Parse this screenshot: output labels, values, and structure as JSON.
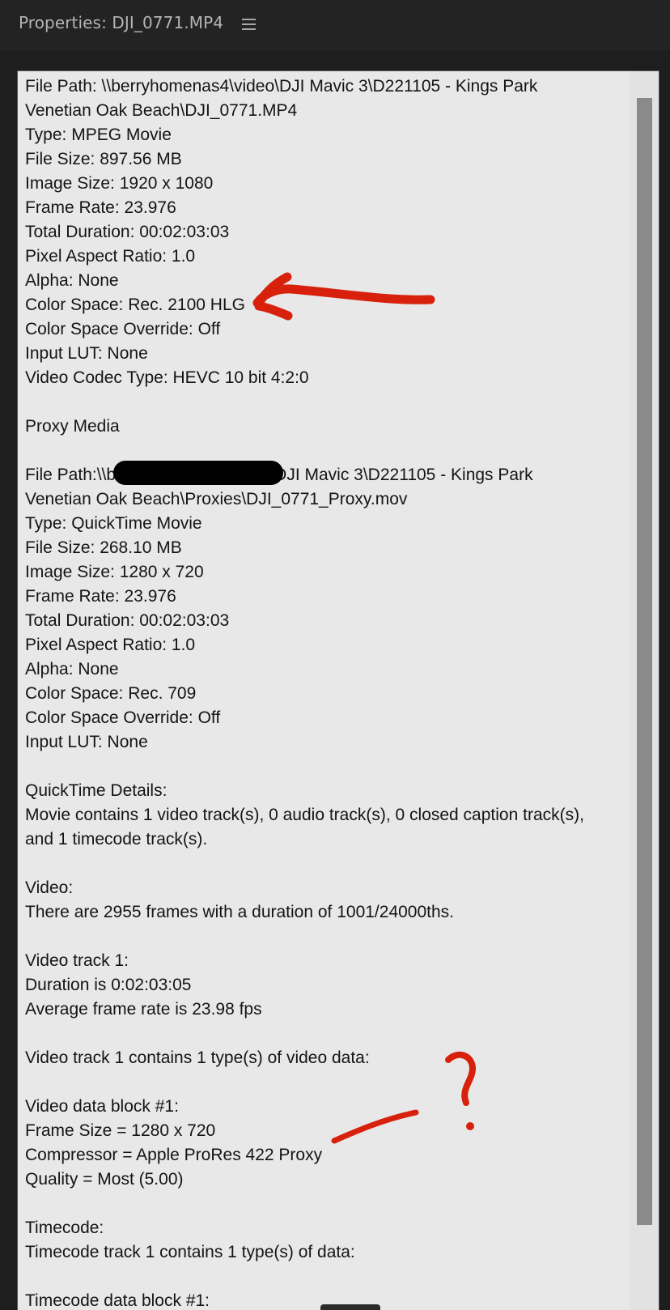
{
  "panel": {
    "title": "Properties: DJI_0771.MP4",
    "menu_icon": "hamburger-menu-icon"
  },
  "properties": {
    "lines": [
      "File Path: \\\\berryhomenas4\\video\\DJI Mavic 3\\D221105 - Kings Park",
      "Venetian Oak Beach\\DJI_0771.MP4",
      "Type: MPEG Movie",
      "File Size: 897.56 MB",
      "Image Size: 1920 x 1080",
      "Frame Rate: 23.976",
      "Total Duration: 00:02:03:03",
      "Pixel Aspect Ratio: 1.0",
      "Alpha: None",
      "Color Space: Rec. 2100 HLG",
      "Color Space Override: Off",
      "Input LUT: None",
      "Video Codec Type: HEVC 10 bit  4:2:0",
      "",
      "Proxy Media",
      "",
      "File Path:\\\\berryhomenas4\\video\\DJI Mavic 3\\D221105 - Kings Park",
      "Venetian Oak Beach\\Proxies\\DJI_0771_Proxy.mov",
      "Type: QuickTime Movie",
      "File Size: 268.10 MB",
      "Image Size: 1280 x 720",
      "Frame Rate: 23.976",
      "Total Duration: 00:02:03:03",
      "Pixel Aspect Ratio: 1.0",
      "Alpha: None",
      "Color Space: Rec. 709",
      "Color Space Override: Off",
      "Input LUT: None",
      "",
      "QuickTime Details:",
      "Movie contains 1 video track(s), 0 audio track(s), 0 closed caption track(s),",
      "and 1 timecode track(s).",
      "",
      "Video:",
      "There are 2955 frames with a duration of 1001/24000ths.",
      "",
      "Video track 1:",
      "Duration is 0:02:03:05",
      "Average frame rate is 23.98 fps",
      "",
      "Video track 1 contains 1 type(s) of video data:",
      "",
      "Video data block #1:",
      "Frame Size = 1280 x 720",
      "Compressor = Apple ProRes 422 Proxy",
      "Quality = Most (5.00)",
      "",
      "Timecode:",
      "Timecode track 1 contains 1 type(s) of data:",
      "",
      "Timecode data block #1:"
    ]
  },
  "annotations": {
    "question_mark": "?",
    "color": "#d8210d"
  },
  "colors": {
    "panel_background": "#232323",
    "content_background": "#e8e8e8",
    "text": "#141414",
    "scroll_thumb": "#8a8a8a"
  }
}
